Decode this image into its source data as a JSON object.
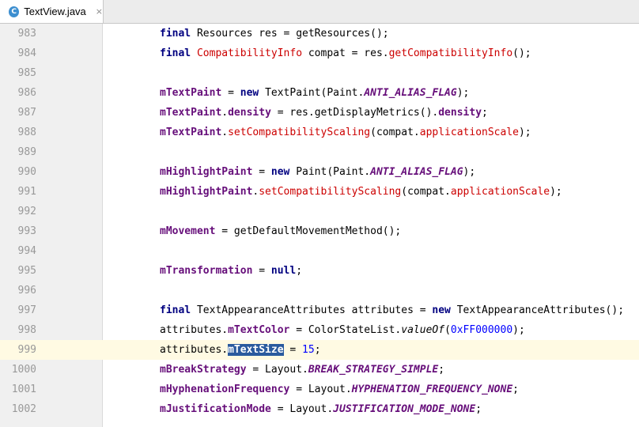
{
  "tab": {
    "title": "TextView.java",
    "icon": "C",
    "close": "×"
  },
  "lines": [
    {
      "no": "983",
      "segs": [
        {
          "t": "final",
          "c": "kw"
        },
        {
          "t": " Resources res = getResources();"
        }
      ]
    },
    {
      "no": "984",
      "segs": [
        {
          "t": "final",
          "c": "kw"
        },
        {
          "t": " "
        },
        {
          "t": "CompatibilityInfo",
          "c": "red"
        },
        {
          "t": " compat = res."
        },
        {
          "t": "getCompatibilityInfo",
          "c": "red"
        },
        {
          "t": "();"
        }
      ]
    },
    {
      "no": "985",
      "segs": []
    },
    {
      "no": "986",
      "segs": [
        {
          "t": "mTextPaint",
          "c": "fld"
        },
        {
          "t": " = "
        },
        {
          "t": "new",
          "c": "kw"
        },
        {
          "t": " TextPaint(Paint."
        },
        {
          "t": "ANTI_ALIAS_FLAG",
          "c": "cst"
        },
        {
          "t": ");"
        }
      ]
    },
    {
      "no": "987",
      "segs": [
        {
          "t": "mTextPaint",
          "c": "fld"
        },
        {
          "t": "."
        },
        {
          "t": "density",
          "c": "fld"
        },
        {
          "t": " = res.getDisplayMetrics()."
        },
        {
          "t": "density",
          "c": "fld"
        },
        {
          "t": ";"
        }
      ]
    },
    {
      "no": "988",
      "segs": [
        {
          "t": "mTextPaint",
          "c": "fld"
        },
        {
          "t": "."
        },
        {
          "t": "setCompatibilityScaling",
          "c": "red"
        },
        {
          "t": "(compat."
        },
        {
          "t": "applicationScale",
          "c": "red"
        },
        {
          "t": ");"
        }
      ]
    },
    {
      "no": "989",
      "segs": []
    },
    {
      "no": "990",
      "segs": [
        {
          "t": "mHighlightPaint",
          "c": "fld"
        },
        {
          "t": " = "
        },
        {
          "t": "new",
          "c": "kw"
        },
        {
          "t": " Paint(Paint."
        },
        {
          "t": "ANTI_ALIAS_FLAG",
          "c": "cst"
        },
        {
          "t": ");"
        }
      ]
    },
    {
      "no": "991",
      "segs": [
        {
          "t": "mHighlightPaint",
          "c": "fld"
        },
        {
          "t": "."
        },
        {
          "t": "setCompatibilityScaling",
          "c": "red"
        },
        {
          "t": "(compat."
        },
        {
          "t": "applicationScale",
          "c": "red"
        },
        {
          "t": ");"
        }
      ]
    },
    {
      "no": "992",
      "segs": []
    },
    {
      "no": "993",
      "segs": [
        {
          "t": "mMovement",
          "c": "fld"
        },
        {
          "t": " = getDefaultMovementMethod();"
        }
      ]
    },
    {
      "no": "994",
      "segs": []
    },
    {
      "no": "995",
      "segs": [
        {
          "t": "mTransformation",
          "c": "fld"
        },
        {
          "t": " = "
        },
        {
          "t": "null",
          "c": "kw"
        },
        {
          "t": ";"
        }
      ]
    },
    {
      "no": "996",
      "segs": []
    },
    {
      "no": "997",
      "segs": [
        {
          "t": "final",
          "c": "kw"
        },
        {
          "t": " TextAppearanceAttributes attributes = "
        },
        {
          "t": "new",
          "c": "kw"
        },
        {
          "t": " TextAppearanceAttributes();"
        }
      ]
    },
    {
      "no": "998",
      "segs": [
        {
          "t": "attributes."
        },
        {
          "t": "mTextColor",
          "c": "fld"
        },
        {
          "t": " = ColorStateList."
        },
        {
          "t": "valueOf",
          "c": "it"
        },
        {
          "t": "("
        },
        {
          "t": "0xFF000000",
          "c": "num"
        },
        {
          "t": ");"
        }
      ]
    },
    {
      "no": "999",
      "current": true,
      "segs": [
        {
          "t": "attributes."
        },
        {
          "t": "mTextSize",
          "c": "fld sel"
        },
        {
          "t": " = "
        },
        {
          "t": "15",
          "c": "num"
        },
        {
          "t": ";"
        }
      ]
    },
    {
      "no": "1000",
      "segs": [
        {
          "t": "mBreakStrategy",
          "c": "fld"
        },
        {
          "t": " = Layout."
        },
        {
          "t": "BREAK_STRATEGY_SIMPLE",
          "c": "cst"
        },
        {
          "t": ";"
        }
      ]
    },
    {
      "no": "1001",
      "segs": [
        {
          "t": "mHyphenationFrequency",
          "c": "fld"
        },
        {
          "t": " = Layout."
        },
        {
          "t": "HYPHENATION_FREQUENCY_NONE",
          "c": "cst"
        },
        {
          "t": ";"
        }
      ]
    },
    {
      "no": "1002",
      "segs": [
        {
          "t": "mJustificationMode",
          "c": "fld"
        },
        {
          "t": " = Layout."
        },
        {
          "t": "JUSTIFICATION_MODE_NONE",
          "c": "cst"
        },
        {
          "t": ";"
        }
      ]
    }
  ]
}
